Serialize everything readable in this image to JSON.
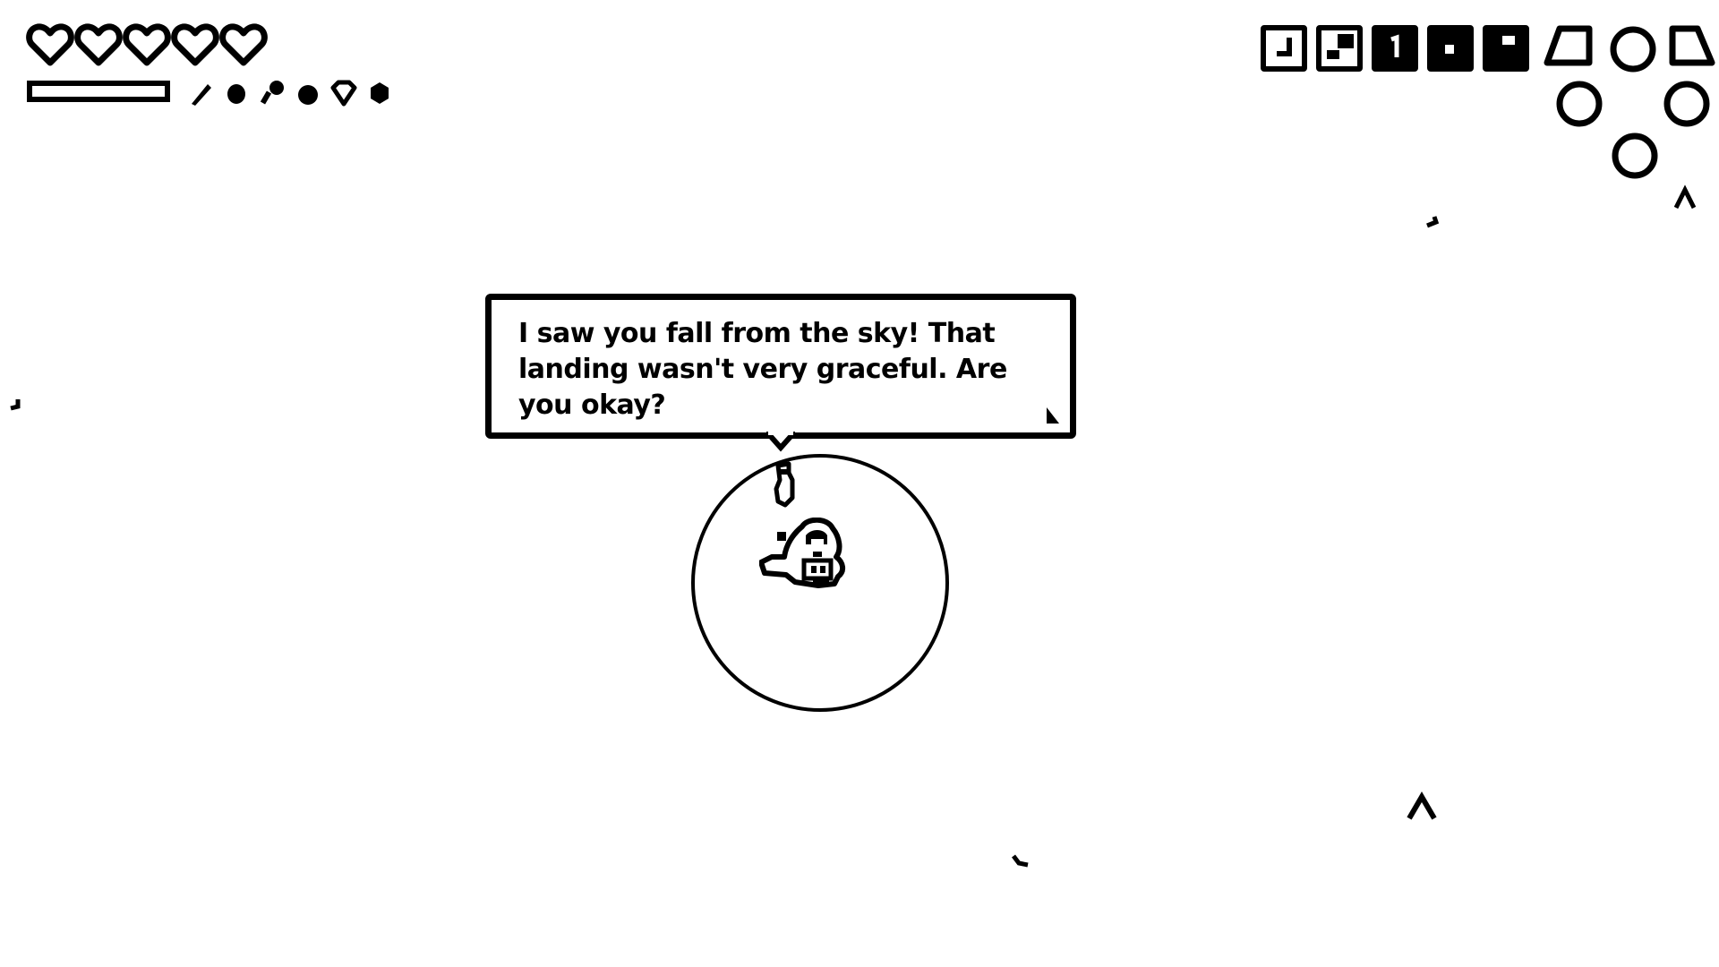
{
  "hud": {
    "hearts": {
      "max": 5,
      "current": 5
    },
    "stamina": {
      "fraction": 0.0
    },
    "resources": [
      "feather-icon",
      "seed-icon",
      "key-icon",
      "orb-icon",
      "gem-icon",
      "coin-icon"
    ],
    "item_slots": [
      {
        "icon": "boomerang-icon",
        "filled": false
      },
      {
        "icon": "block-icon",
        "filled": false
      },
      {
        "icon": "number-one-icon",
        "filled": true
      },
      {
        "icon": "dot-icon",
        "filled": true
      },
      {
        "icon": "flag-icon",
        "filled": true
      }
    ],
    "ability_wheel": [
      "trapezoid-left-icon",
      "circle-icon",
      "trapezoid-right-icon",
      "circle-icon",
      "circle-icon",
      "circle-icon"
    ]
  },
  "dialog": {
    "text": "I saw you fall from the sky! That landing wasn't very graceful. Are you okay?",
    "next_icon": "advance-arrow-icon"
  },
  "world": {
    "player_icon": "hooded-player-icon",
    "npc_icon": "small-npc-icon",
    "range_ring": "interaction-range-ring",
    "markers": [
      "caret-up-icon",
      "caret-up-icon"
    ]
  },
  "colors": {
    "foreground": "#000000",
    "background": "#ffffff"
  }
}
